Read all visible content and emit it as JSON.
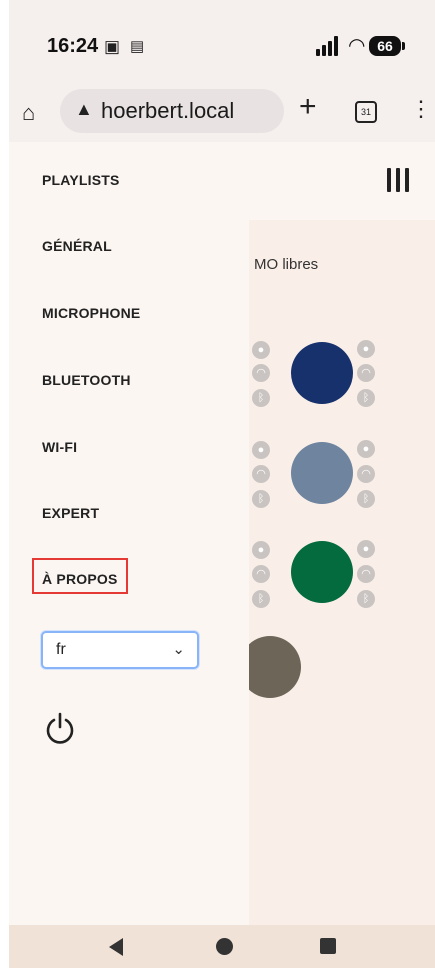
{
  "status_bar": {
    "time": "16:24",
    "battery": "66"
  },
  "browser": {
    "url": "hoerbert.local",
    "tab_count": "31",
    "new_tab": "+"
  },
  "page": {
    "free_text": "MO libres",
    "buttons": [
      {
        "color": "#17316d"
      },
      {
        "color": "#6e849f"
      },
      {
        "color": "#036b3e"
      },
      {
        "color": "#6e6559"
      }
    ]
  },
  "drawer": {
    "items": [
      {
        "label": "PLAYLISTS"
      },
      {
        "label": "GÉNÉRAL"
      },
      {
        "label": "MICROPHONE"
      },
      {
        "label": "BLUETOOTH"
      },
      {
        "label": "WI-FI"
      },
      {
        "label": "EXPERT"
      },
      {
        "label": "À PROPOS"
      }
    ],
    "language": {
      "selected": "fr"
    },
    "highlight_color": "#e53935"
  }
}
